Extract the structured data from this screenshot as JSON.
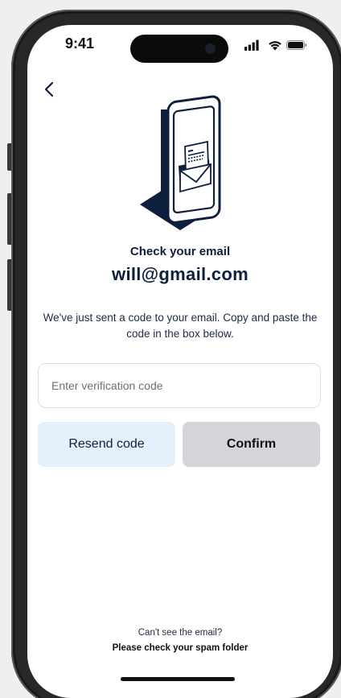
{
  "status_bar": {
    "time": "9:41",
    "icons": [
      "signal-icon",
      "wifi-icon",
      "battery-icon"
    ]
  },
  "header": {
    "back_icon": "chevron-left-icon"
  },
  "content": {
    "heading": "Check your email",
    "email": "will@gmail.com",
    "description": "We've just sent a code to your email. Copy and paste the code in the box below."
  },
  "form": {
    "code_placeholder": "Enter verification code",
    "code_value": "",
    "resend_label": "Resend code",
    "confirm_label": "Confirm"
  },
  "footer": {
    "question": "Can't see the email?",
    "hint": "Please check your spam folder"
  },
  "colors": {
    "navy": "#0e1f3d",
    "resend_bg": "#e4f0fc",
    "confirm_bg": "#d4d5d9",
    "background": "#efeff1"
  }
}
